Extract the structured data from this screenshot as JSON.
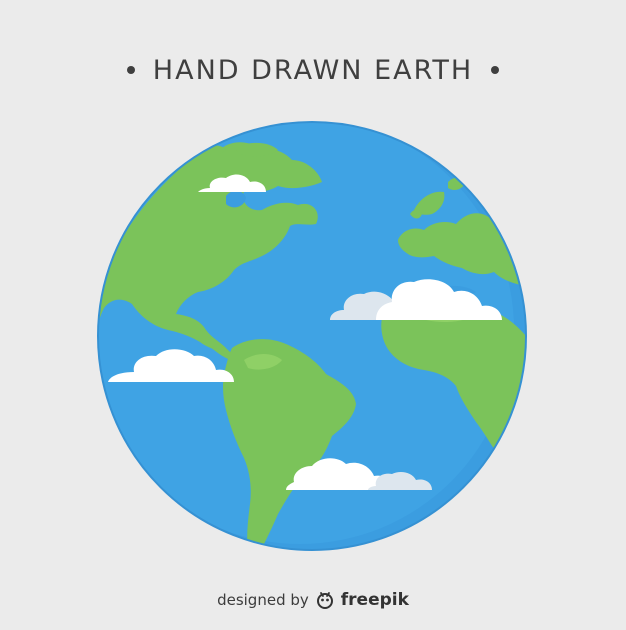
{
  "header": {
    "title": "HAND DRAWN EARTH"
  },
  "colors": {
    "background": "#ebebeb",
    "ocean": "#3b9de0",
    "ocean_shadow": "#3591d3",
    "land": "#7bc35a",
    "land_light": "#8fd066",
    "cloud": "#ffffff",
    "cloud_shade": "#dde6ee",
    "text": "#3f3f3f"
  },
  "footer": {
    "designed_by": "designed by",
    "brand": "freepik",
    "logo_icon": "freepik-logo-icon"
  }
}
